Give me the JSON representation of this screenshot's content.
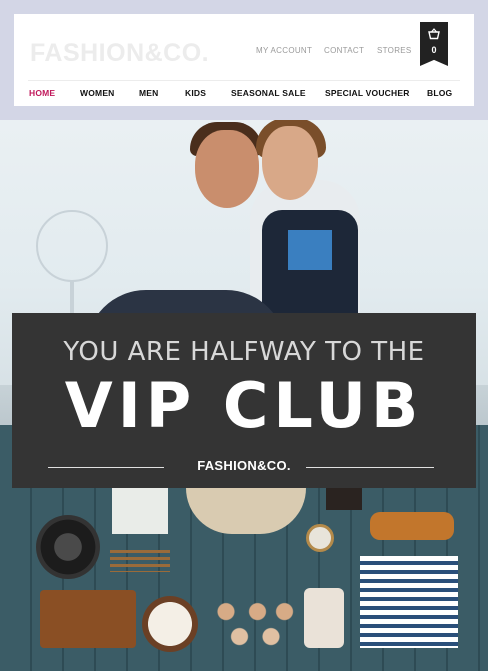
{
  "header": {
    "logo": "FASHION&CO.",
    "utility_links": [
      "MY ACCOUNT",
      "CONTACT",
      "STORES"
    ],
    "cart": {
      "icon": "basket-icon",
      "count": "0"
    },
    "nav": [
      "HOME",
      "WOMEN",
      "MEN",
      "KIDS",
      "SEASONAL SALE",
      "SPECIAL VOUCHER",
      "BLOG"
    ],
    "active_nav": "HOME"
  },
  "banner": {
    "line1": "YOU ARE HALFWAY TO THE",
    "line2": "VIP CLUB",
    "brand": "FASHION&CO."
  },
  "colors": {
    "page_background": "#d3d6e6",
    "accent": "#c0185a",
    "banner_background": "#343434"
  }
}
